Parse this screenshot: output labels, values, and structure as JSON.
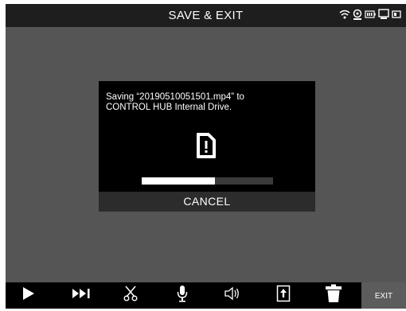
{
  "header": {
    "title": "SAVE & EXIT",
    "status_icons": [
      "wifi-icon",
      "camera-icon",
      "battery-icon",
      "monitor-icon",
      "drive-icon"
    ]
  },
  "dialog": {
    "message_line1": "Saving “20190510051501.mp4” to",
    "message_line2": "CONTROL HUB Internal Drive.",
    "icon": "file-warning-icon",
    "progress_fraction": 0.56,
    "cancel_label": "CANCEL"
  },
  "toolbar": {
    "icons": [
      "play-icon",
      "skip-forward-icon",
      "cut-icon",
      "microphone-icon",
      "volume-icon",
      "export-icon",
      "trash-icon"
    ],
    "exit_label": "EXIT"
  },
  "colors": {
    "background": "#555555",
    "bar": "#1e1e1e",
    "dialog": "#000000",
    "cancel_bar": "#2c2c2c",
    "exit_button": "#5c5c5c"
  }
}
